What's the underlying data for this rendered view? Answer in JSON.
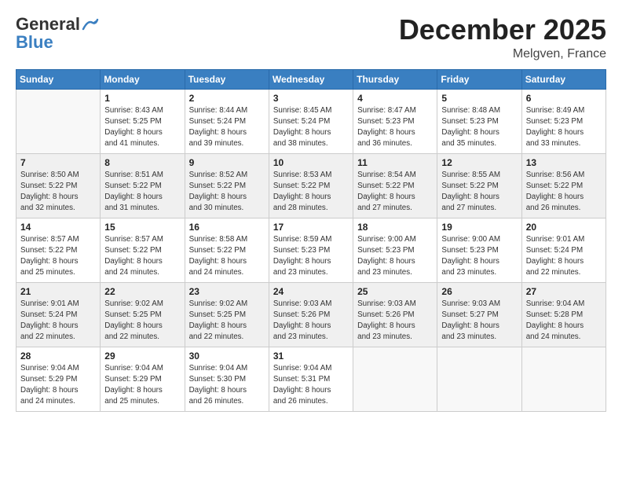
{
  "header": {
    "logo_line1": "General",
    "logo_line2": "Blue",
    "month": "December 2025",
    "location": "Melgven, France"
  },
  "weekdays": [
    "Sunday",
    "Monday",
    "Tuesday",
    "Wednesday",
    "Thursday",
    "Friday",
    "Saturday"
  ],
  "weeks": [
    [
      {
        "day": "",
        "info": ""
      },
      {
        "day": "1",
        "info": "Sunrise: 8:43 AM\nSunset: 5:25 PM\nDaylight: 8 hours\nand 41 minutes."
      },
      {
        "day": "2",
        "info": "Sunrise: 8:44 AM\nSunset: 5:24 PM\nDaylight: 8 hours\nand 39 minutes."
      },
      {
        "day": "3",
        "info": "Sunrise: 8:45 AM\nSunset: 5:24 PM\nDaylight: 8 hours\nand 38 minutes."
      },
      {
        "day": "4",
        "info": "Sunrise: 8:47 AM\nSunset: 5:23 PM\nDaylight: 8 hours\nand 36 minutes."
      },
      {
        "day": "5",
        "info": "Sunrise: 8:48 AM\nSunset: 5:23 PM\nDaylight: 8 hours\nand 35 minutes."
      },
      {
        "day": "6",
        "info": "Sunrise: 8:49 AM\nSunset: 5:23 PM\nDaylight: 8 hours\nand 33 minutes."
      }
    ],
    [
      {
        "day": "7",
        "info": "Sunrise: 8:50 AM\nSunset: 5:22 PM\nDaylight: 8 hours\nand 32 minutes."
      },
      {
        "day": "8",
        "info": "Sunrise: 8:51 AM\nSunset: 5:22 PM\nDaylight: 8 hours\nand 31 minutes."
      },
      {
        "day": "9",
        "info": "Sunrise: 8:52 AM\nSunset: 5:22 PM\nDaylight: 8 hours\nand 30 minutes."
      },
      {
        "day": "10",
        "info": "Sunrise: 8:53 AM\nSunset: 5:22 PM\nDaylight: 8 hours\nand 28 minutes."
      },
      {
        "day": "11",
        "info": "Sunrise: 8:54 AM\nSunset: 5:22 PM\nDaylight: 8 hours\nand 27 minutes."
      },
      {
        "day": "12",
        "info": "Sunrise: 8:55 AM\nSunset: 5:22 PM\nDaylight: 8 hours\nand 27 minutes."
      },
      {
        "day": "13",
        "info": "Sunrise: 8:56 AM\nSunset: 5:22 PM\nDaylight: 8 hours\nand 26 minutes."
      }
    ],
    [
      {
        "day": "14",
        "info": "Sunrise: 8:57 AM\nSunset: 5:22 PM\nDaylight: 8 hours\nand 25 minutes."
      },
      {
        "day": "15",
        "info": "Sunrise: 8:57 AM\nSunset: 5:22 PM\nDaylight: 8 hours\nand 24 minutes."
      },
      {
        "day": "16",
        "info": "Sunrise: 8:58 AM\nSunset: 5:22 PM\nDaylight: 8 hours\nand 24 minutes."
      },
      {
        "day": "17",
        "info": "Sunrise: 8:59 AM\nSunset: 5:23 PM\nDaylight: 8 hours\nand 23 minutes."
      },
      {
        "day": "18",
        "info": "Sunrise: 9:00 AM\nSunset: 5:23 PM\nDaylight: 8 hours\nand 23 minutes."
      },
      {
        "day": "19",
        "info": "Sunrise: 9:00 AM\nSunset: 5:23 PM\nDaylight: 8 hours\nand 23 minutes."
      },
      {
        "day": "20",
        "info": "Sunrise: 9:01 AM\nSunset: 5:24 PM\nDaylight: 8 hours\nand 22 minutes."
      }
    ],
    [
      {
        "day": "21",
        "info": "Sunrise: 9:01 AM\nSunset: 5:24 PM\nDaylight: 8 hours\nand 22 minutes."
      },
      {
        "day": "22",
        "info": "Sunrise: 9:02 AM\nSunset: 5:25 PM\nDaylight: 8 hours\nand 22 minutes."
      },
      {
        "day": "23",
        "info": "Sunrise: 9:02 AM\nSunset: 5:25 PM\nDaylight: 8 hours\nand 22 minutes."
      },
      {
        "day": "24",
        "info": "Sunrise: 9:03 AM\nSunset: 5:26 PM\nDaylight: 8 hours\nand 23 minutes."
      },
      {
        "day": "25",
        "info": "Sunrise: 9:03 AM\nSunset: 5:26 PM\nDaylight: 8 hours\nand 23 minutes."
      },
      {
        "day": "26",
        "info": "Sunrise: 9:03 AM\nSunset: 5:27 PM\nDaylight: 8 hours\nand 23 minutes."
      },
      {
        "day": "27",
        "info": "Sunrise: 9:04 AM\nSunset: 5:28 PM\nDaylight: 8 hours\nand 24 minutes."
      }
    ],
    [
      {
        "day": "28",
        "info": "Sunrise: 9:04 AM\nSunset: 5:29 PM\nDaylight: 8 hours\nand 24 minutes."
      },
      {
        "day": "29",
        "info": "Sunrise: 9:04 AM\nSunset: 5:29 PM\nDaylight: 8 hours\nand 25 minutes."
      },
      {
        "day": "30",
        "info": "Sunrise: 9:04 AM\nSunset: 5:30 PM\nDaylight: 8 hours\nand 26 minutes."
      },
      {
        "day": "31",
        "info": "Sunrise: 9:04 AM\nSunset: 5:31 PM\nDaylight: 8 hours\nand 26 minutes."
      },
      {
        "day": "",
        "info": ""
      },
      {
        "day": "",
        "info": ""
      },
      {
        "day": "",
        "info": ""
      }
    ]
  ]
}
